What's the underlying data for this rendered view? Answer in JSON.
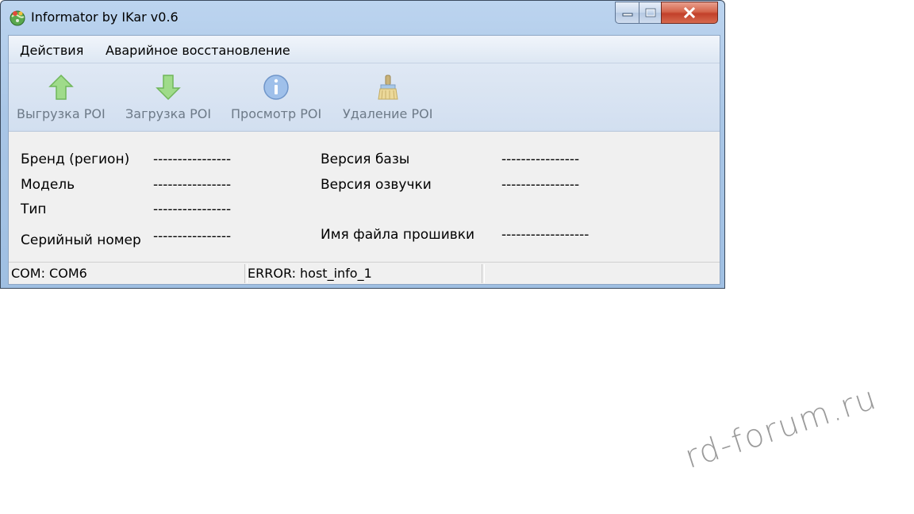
{
  "window": {
    "title": "Informator by IKar v0.6",
    "app_icon": "globe-app-icon",
    "controls": {
      "minimize_icon": "minimize-icon",
      "maximize_icon": "maximize-icon",
      "close_icon": "close-icon"
    }
  },
  "menu": {
    "items": [
      {
        "label_underlined": "Д",
        "label_rest": "ействия"
      },
      {
        "label": "Аварийное восстановление"
      }
    ]
  },
  "toolbar": {
    "buttons": [
      {
        "label": "Выгрузка POI",
        "icon": "arrow-up-icon"
      },
      {
        "label": "Загрузка POI",
        "icon": "arrow-down-icon"
      },
      {
        "label": "Просмотр POI",
        "icon": "info-icon"
      },
      {
        "label": "Удаление POI",
        "icon": "brush-icon"
      }
    ]
  },
  "info": {
    "brand_label": "Бренд (регион)",
    "brand_value": "----------------",
    "model_label": "Модель",
    "model_value": "----------------",
    "type_label": "Тип",
    "type_value": "----------------",
    "serial_label": "Серийный номер",
    "serial_value": "----------------",
    "db_version_label": "Версия базы",
    "db_version_value": "----------------",
    "voice_version_label": "Версия озвучки",
    "voice_version_value": "----------------",
    "firmware_label": "Имя файла прошивки",
    "firmware_value": "------------------"
  },
  "status": {
    "com": "COM: COM6",
    "error": "ERROR: host_info_1",
    "extra": ""
  },
  "watermark": "rd-forum.ru",
  "colors": {
    "frame": "#a9c6e6",
    "close_button": "#c2402a",
    "toolbar_label": "#6d7a88",
    "icon_green": "#8fd27a"
  }
}
